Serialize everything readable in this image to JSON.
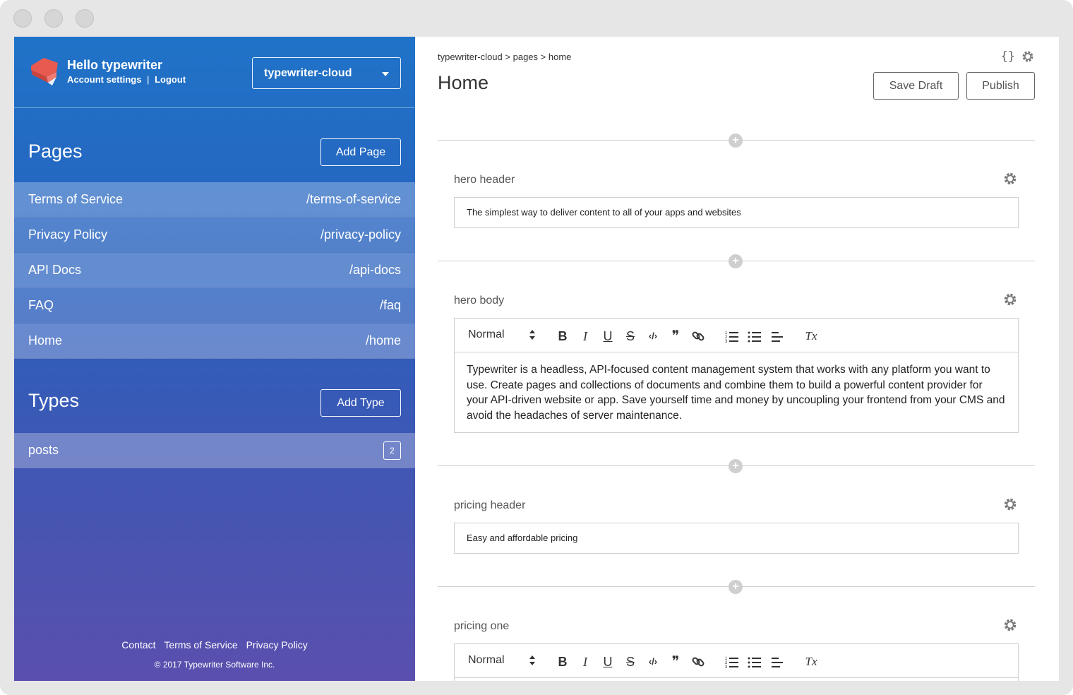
{
  "sidebar": {
    "greeting": "Hello typewriter",
    "account_settings": "Account settings",
    "separator": "|",
    "logout": "Logout",
    "project": "typewriter-cloud",
    "pages_title": "Pages",
    "add_page": "Add Page",
    "pages": [
      {
        "name": "Terms of Service",
        "slug": "/terms-of-service"
      },
      {
        "name": "Privacy Policy",
        "slug": "/privacy-policy"
      },
      {
        "name": "API Docs",
        "slug": "/api-docs"
      },
      {
        "name": "FAQ",
        "slug": "/faq"
      },
      {
        "name": "Home",
        "slug": "/home"
      }
    ],
    "types_title": "Types",
    "add_type": "Add Type",
    "types": [
      {
        "name": "posts",
        "count": "2"
      }
    ],
    "footer": {
      "contact": "Contact",
      "terms": "Terms of Service",
      "privacy": "Privacy Policy",
      "copyright": "© 2017 Typewriter Software Inc."
    }
  },
  "main": {
    "breadcrumb": {
      "project": "typewriter-cloud",
      "sep": ">",
      "section": "pages",
      "page": "home"
    },
    "title": "Home",
    "save_draft": "Save Draft",
    "publish": "Publish",
    "braces_icon": "{}",
    "blocks": [
      {
        "label": "hero header",
        "value": "The simplest way to deliver content to all of your apps and websites"
      },
      {
        "label": "hero body",
        "style": "Normal",
        "value": "Typewriter is a headless, API-focused content management system that works with any platform you want to use. Create pages and collections of documents and combine them to build a powerful content provider for your API-driven website or app. Save yourself time and money by uncoupling your frontend from your CMS and avoid the headaches of server maintenance."
      },
      {
        "label": "pricing header",
        "value": "Easy and affordable pricing"
      },
      {
        "label": "pricing one",
        "style": "Normal"
      }
    ],
    "toolbar_glyphs": {
      "bold": "B",
      "italic": "I",
      "underline": "U",
      "strike": "S",
      "code": "‹/›",
      "quote": "❞",
      "clear": "Tx"
    }
  },
  "colors": {
    "sidebar_top": "#1f73c8",
    "sidebar_bottom": "#5a4fae",
    "logo_red": "#e85a4f",
    "divider": "#cfcfcf"
  },
  "icons": [
    "typewriter-logo-icon",
    "chevron-down-icon",
    "braces-icon",
    "gear-icon",
    "plus-icon",
    "bold-icon",
    "italic-icon",
    "underline-icon",
    "strikethrough-icon",
    "code-icon",
    "quote-icon",
    "link-icon",
    "ordered-list-icon",
    "bullet-list-icon",
    "align-icon",
    "clear-format-icon"
  ]
}
